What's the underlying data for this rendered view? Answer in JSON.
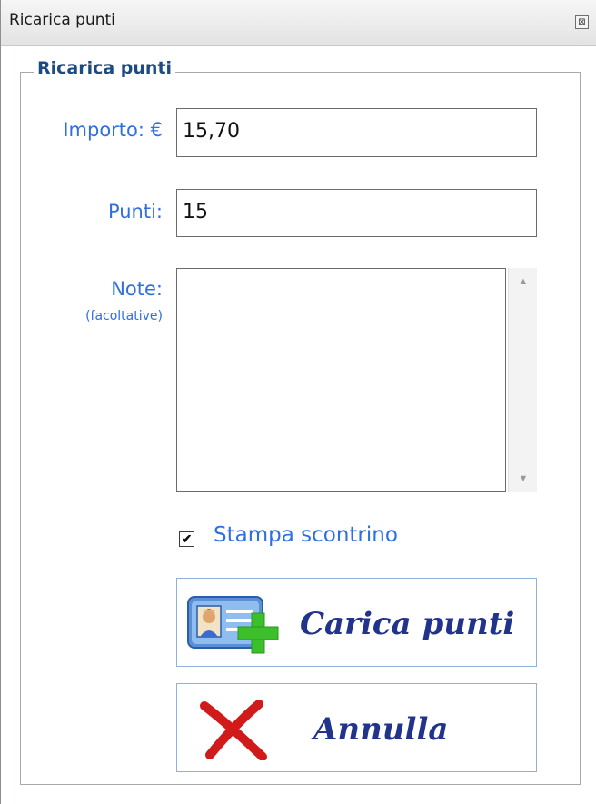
{
  "window": {
    "title": "Ricarica punti",
    "close_symbol": "⊠"
  },
  "group": {
    "legend": "Ricarica punti"
  },
  "form": {
    "importo_label": "Importo: €",
    "importo_value": "15,70",
    "punti_label": "Punti:",
    "punti_value": "15",
    "note_label": "Note:",
    "note_hint": "(facoltative)",
    "note_value": ""
  },
  "print_receipt": {
    "label": "Stampa scontrino",
    "checked": true,
    "mark": "✔"
  },
  "buttons": {
    "carica": {
      "label": "Carica punti",
      "icon": "add-card-icon"
    },
    "annulla": {
      "label": "Annulla",
      "icon": "red-x-icon"
    }
  },
  "scrollbar": {
    "up": "▲",
    "down": "▼"
  },
  "colors": {
    "label_blue": "#2f6fe0",
    "legend_blue": "#1b4a84",
    "button_text": "#22338c",
    "cancel_red": "#d11a1a",
    "plus_green": "#3bbf2a"
  }
}
